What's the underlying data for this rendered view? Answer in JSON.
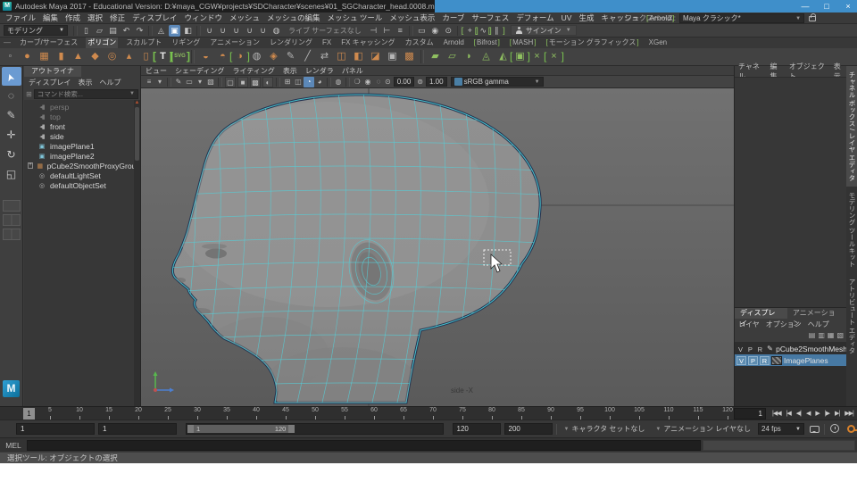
{
  "title_bar": {
    "title": "Autodesk Maya 2017 - Educational Version: D:¥maya_CGW¥projects¥SDCharacter¥scenes¥01_SGCharacter_head.0008.mb*",
    "minimize": "—",
    "maximize": "□",
    "close": "×"
  },
  "menu_bar": {
    "items": [
      {
        "label": "ファイル"
      },
      {
        "label": "編集"
      },
      {
        "label": "作成"
      },
      {
        "label": "選択"
      },
      {
        "label": "修正"
      },
      {
        "label": "ディスプレイ"
      },
      {
        "label": "ウィンドウ"
      },
      {
        "label": "メッシュ"
      },
      {
        "label": "メッシュの編集"
      },
      {
        "label": "メッシュ ツール"
      },
      {
        "label": "メッシュ表示"
      },
      {
        "label": "カーブ"
      },
      {
        "label": "サーフェス"
      },
      {
        "label": "デフォーム"
      },
      {
        "label": "UV"
      },
      {
        "label": "生成"
      },
      {
        "label": "キャッシュ"
      },
      {
        "label": "Arnold",
        "bracket": true
      },
      {
        "label": "ヘルプ"
      }
    ],
    "workspace_label": "ワークスペース:",
    "workspace_value": "Maya クラシック*"
  },
  "status_line": {
    "mode": "モデリング",
    "live_surface": "ライブ サーフェスなし",
    "sign_in": "サインイン",
    "icons": [
      {
        "n": "new-scene-icon",
        "g": "▯"
      },
      {
        "n": "open-scene-icon",
        "g": "▱"
      },
      {
        "n": "save-scene-icon",
        "g": "▤"
      },
      {
        "n": "undo-icon",
        "g": "↶"
      },
      {
        "n": "redo-icon",
        "g": "↷"
      },
      {
        "n": "sep",
        "sep": true
      },
      {
        "n": "select-hierarchy-icon",
        "g": "◬"
      },
      {
        "n": "select-object-icon",
        "g": "▣",
        "active": true
      },
      {
        "n": "select-component-icon",
        "g": "◧"
      },
      {
        "n": "sep",
        "sep": true
      },
      {
        "n": "snap-grid-icon",
        "g": "∪"
      },
      {
        "n": "snap-curve-icon",
        "g": "∪"
      },
      {
        "n": "snap-point-icon",
        "g": "∪"
      },
      {
        "n": "snap-plane-icon",
        "g": "∪"
      },
      {
        "n": "snap-view-icon",
        "g": "∪"
      },
      {
        "n": "make-live-icon",
        "g": "◍"
      }
    ],
    "icons2": [
      {
        "n": "input-connections-icon",
        "g": "⊣"
      },
      {
        "n": "output-connections-icon",
        "g": "⊢"
      },
      {
        "n": "construction-history-icon",
        "g": "≡"
      },
      {
        "n": "sep",
        "sep": true
      },
      {
        "n": "render-icon",
        "g": "▭"
      },
      {
        "n": "ipr-render-icon",
        "g": "◉"
      },
      {
        "n": "render-settings-icon",
        "g": "⊙"
      },
      {
        "n": "sep",
        "sep": true
      },
      {
        "n": "modeling-toolkit-icon",
        "g": "+",
        "bracket": true
      },
      {
        "n": "symmetry-icon",
        "g": "∿",
        "bracket": true
      },
      {
        "n": "pause-icon",
        "g": "∥",
        "bracket": true
      }
    ]
  },
  "shelf": {
    "tabs": [
      {
        "label": "カーブ/サーフェス"
      },
      {
        "label": "ポリゴン",
        "active": true
      },
      {
        "label": "スカルプト"
      },
      {
        "label": "リギング"
      },
      {
        "label": "アニメーション"
      },
      {
        "label": "レンダリング"
      },
      {
        "label": "FX"
      },
      {
        "label": "FX キャッシング"
      },
      {
        "label": "カスタム"
      },
      {
        "label": "Arnold"
      },
      {
        "label": "Bifrost",
        "bracket": true
      },
      {
        "label": "MASH",
        "bracket": true
      },
      {
        "label": "モーション グラフィックス",
        "bracket": true
      },
      {
        "label": "XGen"
      }
    ],
    "icons": [
      {
        "n": "shelf-popup-icon",
        "g": "◦",
        "c": "gray"
      },
      {
        "n": "poly-sphere-icon",
        "g": "●",
        "c": "orange"
      },
      {
        "n": "poly-cube-icon",
        "g": "▦",
        "c": "orange"
      },
      {
        "n": "poly-cylinder-icon",
        "g": "▮",
        "c": "orange"
      },
      {
        "n": "poly-cone-icon",
        "g": "▲",
        "c": "orange"
      },
      {
        "n": "poly-plane-icon",
        "g": "◆",
        "c": "orange"
      },
      {
        "n": "poly-torus-icon",
        "g": "◎",
        "c": "orange"
      },
      {
        "n": "poly-pyramid-icon",
        "g": "▴",
        "c": "orange"
      },
      {
        "n": "poly-pipe-icon",
        "g": "▯",
        "c": "orange"
      },
      {
        "n": "poly-type-icon",
        "g": "T",
        "c": "white",
        "bracket": true
      },
      {
        "n": "poly-svg-icon",
        "g": "SVG",
        "c": "green tiny",
        "bracket": true
      },
      {
        "n": "sep",
        "sep": true
      },
      {
        "n": "combine-icon",
        "g": "◒",
        "c": "orange"
      },
      {
        "n": "separate-icon",
        "g": "◓",
        "c": "orange"
      },
      {
        "n": "mirror-icon",
        "g": "◑",
        "c": "orange",
        "bracket": true
      },
      {
        "n": "smooth-icon",
        "g": "◍",
        "c": "gray"
      },
      {
        "n": "subdiv-proxy-icon",
        "g": "◈",
        "c": "orange"
      },
      {
        "n": "crease-tool-icon",
        "g": "✎",
        "c": "gray"
      },
      {
        "n": "multi-cut-icon",
        "g": "╱",
        "c": "gray"
      },
      {
        "n": "connect-icon",
        "g": "⇄",
        "c": "gray"
      },
      {
        "n": "bridge-icon",
        "g": "◫",
        "c": "orange"
      },
      {
        "n": "extrude-icon",
        "g": "◧",
        "c": "orange"
      },
      {
        "n": "bevel-icon",
        "g": "◪",
        "c": "orange"
      },
      {
        "n": "boolean-icon",
        "g": "▣",
        "c": "gray"
      },
      {
        "n": "quad-draw-icon",
        "g": "▩",
        "c": "orange"
      },
      {
        "n": "sep",
        "sep": true
      },
      {
        "n": "append-face-icon",
        "g": "▰",
        "c": "green"
      },
      {
        "n": "delete-edge-icon",
        "g": "▱",
        "c": "green"
      },
      {
        "n": "collapse-edge-icon",
        "g": "◗",
        "c": "green"
      },
      {
        "n": "spin-edge-icon",
        "g": "◬",
        "c": "green"
      },
      {
        "n": "flip-edge-icon",
        "g": "◭",
        "c": "green"
      },
      {
        "n": "target-weld-icon",
        "g": "▣",
        "c": "green",
        "bracket": true
      },
      {
        "n": "merge-vertex-icon",
        "g": "×",
        "c": "green"
      },
      {
        "n": "delete-component-icon",
        "g": "×",
        "c": "green",
        "bracket": true
      }
    ]
  },
  "outliner": {
    "tab": "アウトライナ",
    "menus": [
      "ディスプレイ",
      "表示",
      "ヘルプ"
    ],
    "search_placeholder": "コマンド検索...",
    "items": [
      {
        "icon": "camera",
        "label": "persp",
        "dimmed": true
      },
      {
        "icon": "camera",
        "label": "top",
        "dimmed": true
      },
      {
        "icon": "camera",
        "label": "front"
      },
      {
        "icon": "camera",
        "label": "side"
      },
      {
        "icon": "imageplane",
        "label": "imagePlane1"
      },
      {
        "icon": "imageplane",
        "label": "imagePlane2"
      },
      {
        "icon": "group",
        "label": "pCube2SmoothProxyGroup",
        "expand": true
      },
      {
        "icon": "set",
        "label": "defaultLightSet"
      },
      {
        "icon": "set",
        "label": "defaultObjectSet"
      }
    ]
  },
  "viewport": {
    "menus": [
      "ビュー",
      "シェーディング",
      "ライティング",
      "表示",
      "レンダラ",
      "パネル"
    ],
    "icons": [
      {
        "n": "panel-menu-icon",
        "g": "≡"
      },
      {
        "n": "camera-select-icon",
        "g": "▾"
      },
      {
        "n": "sep",
        "sep": true
      },
      {
        "n": "grease-pencil-icon",
        "g": "✎"
      },
      {
        "n": "camera-lock-icon",
        "g": "▭"
      },
      {
        "n": "bookmark-icon",
        "g": "▾"
      },
      {
        "n": "image-plane-icon",
        "g": "▧"
      },
      {
        "n": "sep",
        "sep": true
      },
      {
        "n": "wireframe-icon",
        "g": "▢",
        "boxed": true
      },
      {
        "n": "shaded-icon",
        "g": "■",
        "boxed": true
      },
      {
        "n": "textured-icon",
        "g": "▩",
        "boxed": true
      },
      {
        "n": "use-all-lights-icon",
        "g": "◐",
        "boxed": true
      },
      {
        "n": "sep",
        "sep": true
      },
      {
        "n": "resolution-gate-icon",
        "g": "⊞"
      },
      {
        "n": "field-chart-icon",
        "g": "◫"
      },
      {
        "n": "xray-icon",
        "g": "◔",
        "active": true
      },
      {
        "n": "xray-joints-icon",
        "g": "◕"
      },
      {
        "n": "sep",
        "sep": true
      },
      {
        "n": "isolate-select-icon",
        "g": "◍"
      },
      {
        "n": "sep",
        "sep": true
      },
      {
        "n": "shadows-icon",
        "g": "❍"
      },
      {
        "n": "ao-icon",
        "g": "◉"
      },
      {
        "n": "anti-alias-icon",
        "g": "◌"
      }
    ],
    "exposure_value": "0.00",
    "gamma_value": "1.00",
    "color_space": "sRGB gamma",
    "view_label": "side -X"
  },
  "channel_box": {
    "menus": [
      "チャネル",
      "編集",
      "オブジェクト",
      "表示"
    ]
  },
  "side_tabs": [
    {
      "label": "チャネル ボックス / レイヤ エディタ",
      "active": true
    },
    {
      "label": "モデリング ツールキット"
    },
    {
      "label": "アトリビュート エディタ"
    }
  ],
  "layer_editor": {
    "tabs": [
      {
        "label": "ディスプレイ",
        "active": true
      },
      {
        "label": "アニメーション"
      }
    ],
    "menus": [
      "レイヤ",
      "オプション",
      "ヘルプ"
    ],
    "icons": [
      {
        "n": "layer-move-up-icon",
        "g": "▤"
      },
      {
        "n": "layer-move-down-icon",
        "g": "▥"
      },
      {
        "n": "layer-empty-new-icon",
        "g": "▦"
      },
      {
        "n": "layer-new-from-selected-icon",
        "g": "▧"
      }
    ],
    "layers": [
      {
        "v": "V",
        "p": "P",
        "r": "R",
        "swatch": "pencil",
        "name": "pCube2SmoothMesh"
      },
      {
        "v": "V",
        "p": "P",
        "r": "R",
        "swatch": "hatch",
        "name": "ImagePlanes",
        "selected": true
      }
    ]
  },
  "time_slider": {
    "current_frame": "1",
    "tick_labels": [
      "5",
      "10",
      "15",
      "20",
      "25",
      "30",
      "35",
      "40",
      "45",
      "50",
      "55",
      "60",
      "65",
      "70",
      "75",
      "80",
      "85",
      "90",
      "95",
      "100",
      "105",
      "110",
      "115",
      "120"
    ],
    "time_field": "1",
    "playback": [
      {
        "n": "go-to-start-button",
        "g": "|◀◀"
      },
      {
        "n": "step-back-frame-button",
        "g": "|◀"
      },
      {
        "n": "step-back-key-button",
        "g": "◀|"
      },
      {
        "n": "play-backwards-button",
        "g": "◀"
      },
      {
        "n": "play-forwards-button",
        "g": "▶"
      },
      {
        "n": "next-key-button",
        "g": "|▶"
      },
      {
        "n": "next-frame-button",
        "g": "▶|"
      },
      {
        "n": "go-to-end-button",
        "g": "▶▶|"
      }
    ]
  },
  "range_slider": {
    "anim_start": "1",
    "playback_start": "1",
    "bar_start_label": "1",
    "bar_end_label": "120",
    "playback_end": "120",
    "anim_end": "200",
    "character_set": "キャラクタ セットなし",
    "anim_layer": "アニメーション レイヤなし",
    "fps": "24 fps"
  },
  "command_line": {
    "label": "MEL"
  },
  "help_line": {
    "text": "選択ツール: オブジェクトの選択"
  }
}
